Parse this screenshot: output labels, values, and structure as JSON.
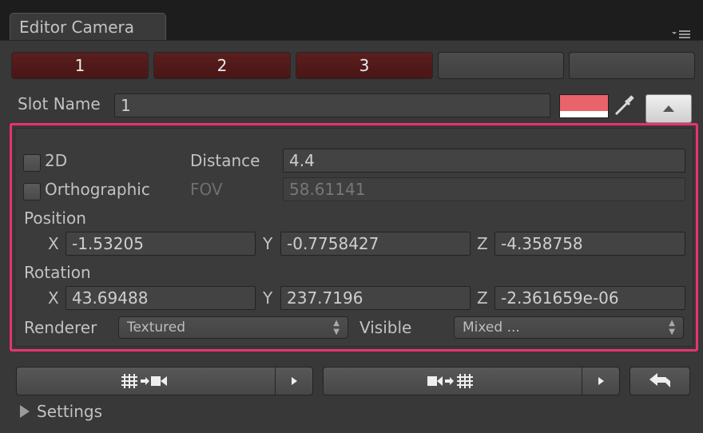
{
  "window": {
    "tab_title": "Editor Camera"
  },
  "slots": [
    "1",
    "2",
    "3",
    "",
    ""
  ],
  "slot_name": {
    "label": "Slot Name",
    "value": "1",
    "color": "#e8646a"
  },
  "highlight_color": "#e8336d",
  "camera": {
    "two_d": {
      "label": "2D",
      "checked": false
    },
    "orthographic": {
      "label": "Orthographic",
      "checked": false
    },
    "distance": {
      "label": "Distance",
      "value": "4.4"
    },
    "fov": {
      "label": "FOV",
      "value": "58.61141"
    },
    "position": {
      "label": "Position",
      "x_label": "X",
      "x": "-1.53205",
      "y_label": "Y",
      "y": "-0.7758427",
      "z_label": "Z",
      "z": "-4.358758"
    },
    "rotation": {
      "label": "Rotation",
      "x_label": "X",
      "x": "43.69488",
      "y_label": "Y",
      "y": "237.7196",
      "z_label": "Z",
      "z": "-2.361659e-06"
    },
    "renderer": {
      "label": "Renderer",
      "value": "Textured"
    },
    "visible": {
      "label": "Visible",
      "value": "Mixed ..."
    }
  },
  "settings": {
    "label": "Settings"
  },
  "icons": {
    "scene_to_camera": "grid-to-camera-icon",
    "camera_to_scene": "camera-to-grid-icon",
    "undo": "undo-arrow-icon"
  }
}
